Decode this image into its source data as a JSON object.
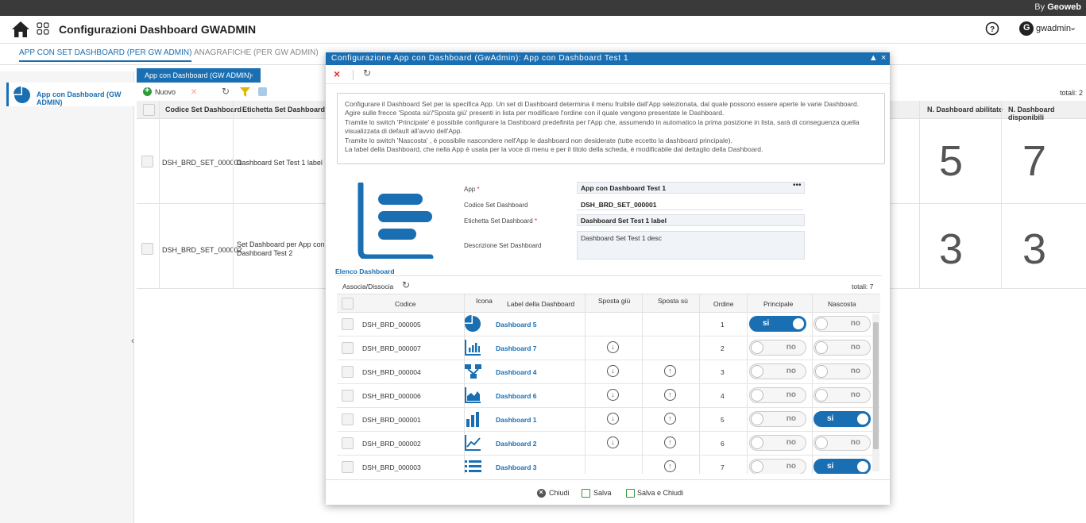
{
  "brand": {
    "by": "By",
    "name": "Geoweb"
  },
  "header": {
    "title": "Configurazioni Dashboard GWADMIN",
    "user": "gwadmin"
  },
  "main_tabs": [
    {
      "label": "APP CON SET DASHBOARD (PER GW ADMIN)"
    },
    {
      "label": "ANAGRAFICHE (PER GW ADMIN)"
    }
  ],
  "sidebar": {
    "item": "App con Dashboard (GW ADMIN)"
  },
  "subtab": {
    "label": "App con Dashboard (GW ADMIN)"
  },
  "toolbar": {
    "new_label": "Nuovo",
    "totals": "totali: 2"
  },
  "grid": {
    "headers": [
      "Codice Set Dashboard",
      "Etichetta Set Dashboard",
      "N. Dashboard abilitate",
      "N. Dashboard disponibili"
    ],
    "rows": [
      {
        "code": "DSH_BRD_SET_000001",
        "label": "Dashboard Set Test 1 label",
        "label2": "",
        "enabled": "5",
        "available": "7"
      },
      {
        "code": "DSH_BRD_SET_000002",
        "label": "Set Dashboard per App con",
        "label2": "Dashboard Test 2",
        "enabled": "3",
        "available": "3"
      }
    ]
  },
  "modal": {
    "title": "Configurazione App con Dashboard (GwAdmin): App con Dashboard Test 1",
    "info": [
      "Configurare il Dashboard Set per la specifica App. Un set di Dashboard determina il menu fruibile dall'App selezionata, dal quale possono essere aperte le varie Dashboard.",
      "Agire sulle frecce 'Sposta sù'/'Sposta giù' presenti in lista per modificare l'ordine con il quale vengono presentate le Dashboard.",
      "Tramite lo switch 'Principale' è possibile configurare la Dashboard predefinita per l'App che, assumendo in automatico la prima posizione in lista, sarà di conseguenza quella",
      "visualizzata di default all'avvio dell'App.",
      "Tramite lo switch 'Nascosta' , è possibile nascondere nell'App le dashboard non desiderate (tutte eccetto la dashboard principale).",
      "La label della Dashboard, che nella App è usata per la voce di menu e per il titolo della scheda, è modificabile dal dettaglio della Dashboard."
    ],
    "form": {
      "app_label": "App",
      "app_value": "App con Dashboard Test 1",
      "code_label": "Codice Set Dashboard",
      "code_value": "DSH_BRD_SET_000001",
      "label_label": "Etichetta Set Dashboard",
      "label_value": "Dashboard Set Test 1 label",
      "desc_label": "Descrizione Set Dashboard",
      "desc_value": "Dashboard Set Test 1 desc"
    },
    "list_title": "Elenco Dashboard",
    "associa": "Associa/Dissocia",
    "totals": "totali: 7",
    "list_headers": [
      "Codice",
      "Icona",
      "Label della Dashboard",
      "Sposta giù",
      "Sposta sù",
      "Ordine",
      "Principale",
      "Nascosta"
    ],
    "dashboards": [
      {
        "code": "DSH_BRD_000005",
        "icon": "pie-chart-icon",
        "label": "Dashboard 5",
        "down": false,
        "up": false,
        "order": "1",
        "main": "si",
        "hidden": "no"
      },
      {
        "code": "DSH_BRD_000007",
        "icon": "bar-chart-icon",
        "label": "Dashboard 7",
        "down": true,
        "up": false,
        "order": "2",
        "main": "no",
        "hidden": "no"
      },
      {
        "code": "DSH_BRD_000004",
        "icon": "flow-icon",
        "label": "Dashboard 4",
        "down": true,
        "up": true,
        "order": "3",
        "main": "no",
        "hidden": "no"
      },
      {
        "code": "DSH_BRD_000006",
        "icon": "area-chart-icon",
        "label": "Dashboard 6",
        "down": true,
        "up": true,
        "order": "4",
        "main": "no",
        "hidden": "no"
      },
      {
        "code": "DSH_BRD_000001",
        "icon": "column-chart-icon",
        "label": "Dashboard 1",
        "down": true,
        "up": true,
        "order": "5",
        "main": "no",
        "hidden": "si"
      },
      {
        "code": "DSH_BRD_000002",
        "icon": "line-chart-icon",
        "label": "Dashboard 2",
        "down": true,
        "up": true,
        "order": "6",
        "main": "no",
        "hidden": "no"
      },
      {
        "code": "DSH_BRD_000003",
        "icon": "list-icon",
        "label": "Dashboard 3",
        "down": false,
        "up": true,
        "order": "7",
        "main": "no",
        "hidden": "si"
      }
    ],
    "footer": {
      "close": "Chiudi",
      "save": "Salva",
      "save_close": "Salva e Chiudi"
    }
  },
  "colors": {
    "accent": "#1a6fb3",
    "topbar": "#3a3a3a"
  }
}
